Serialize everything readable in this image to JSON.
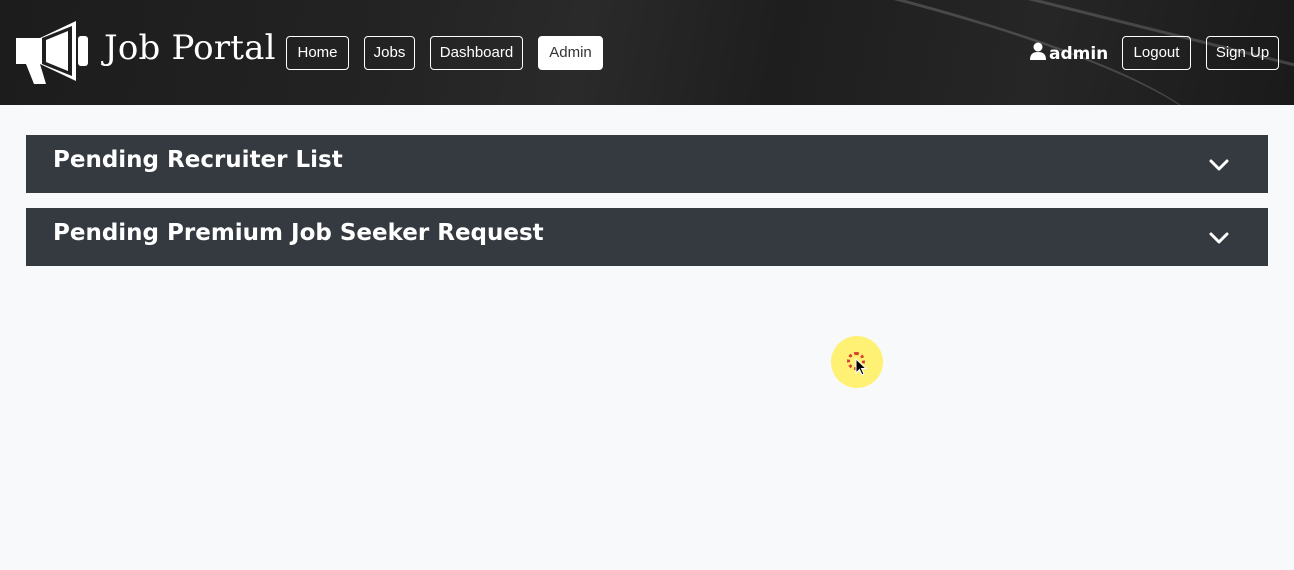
{
  "brand": {
    "title": "Job Portal",
    "icon": "megaphone-icon"
  },
  "nav": {
    "home": "Home",
    "jobs": "Jobs",
    "dashboard": "Dashboard",
    "admin": "Admin"
  },
  "user": {
    "name": "admin",
    "icon": "user-icon"
  },
  "auth": {
    "logout": "Logout",
    "signup": "Sign Up"
  },
  "sections": [
    {
      "title": "Pending Recruiter List",
      "icon": "chevron-down-icon"
    },
    {
      "title": "Pending Premium Job Seeker Request",
      "icon": "chevron-down-icon"
    }
  ],
  "colors": {
    "navbar": "#1f1f1f",
    "accordion": "#343a40",
    "page_background": "#f8f9fa",
    "cursor_highlight": "#fff05a"
  }
}
